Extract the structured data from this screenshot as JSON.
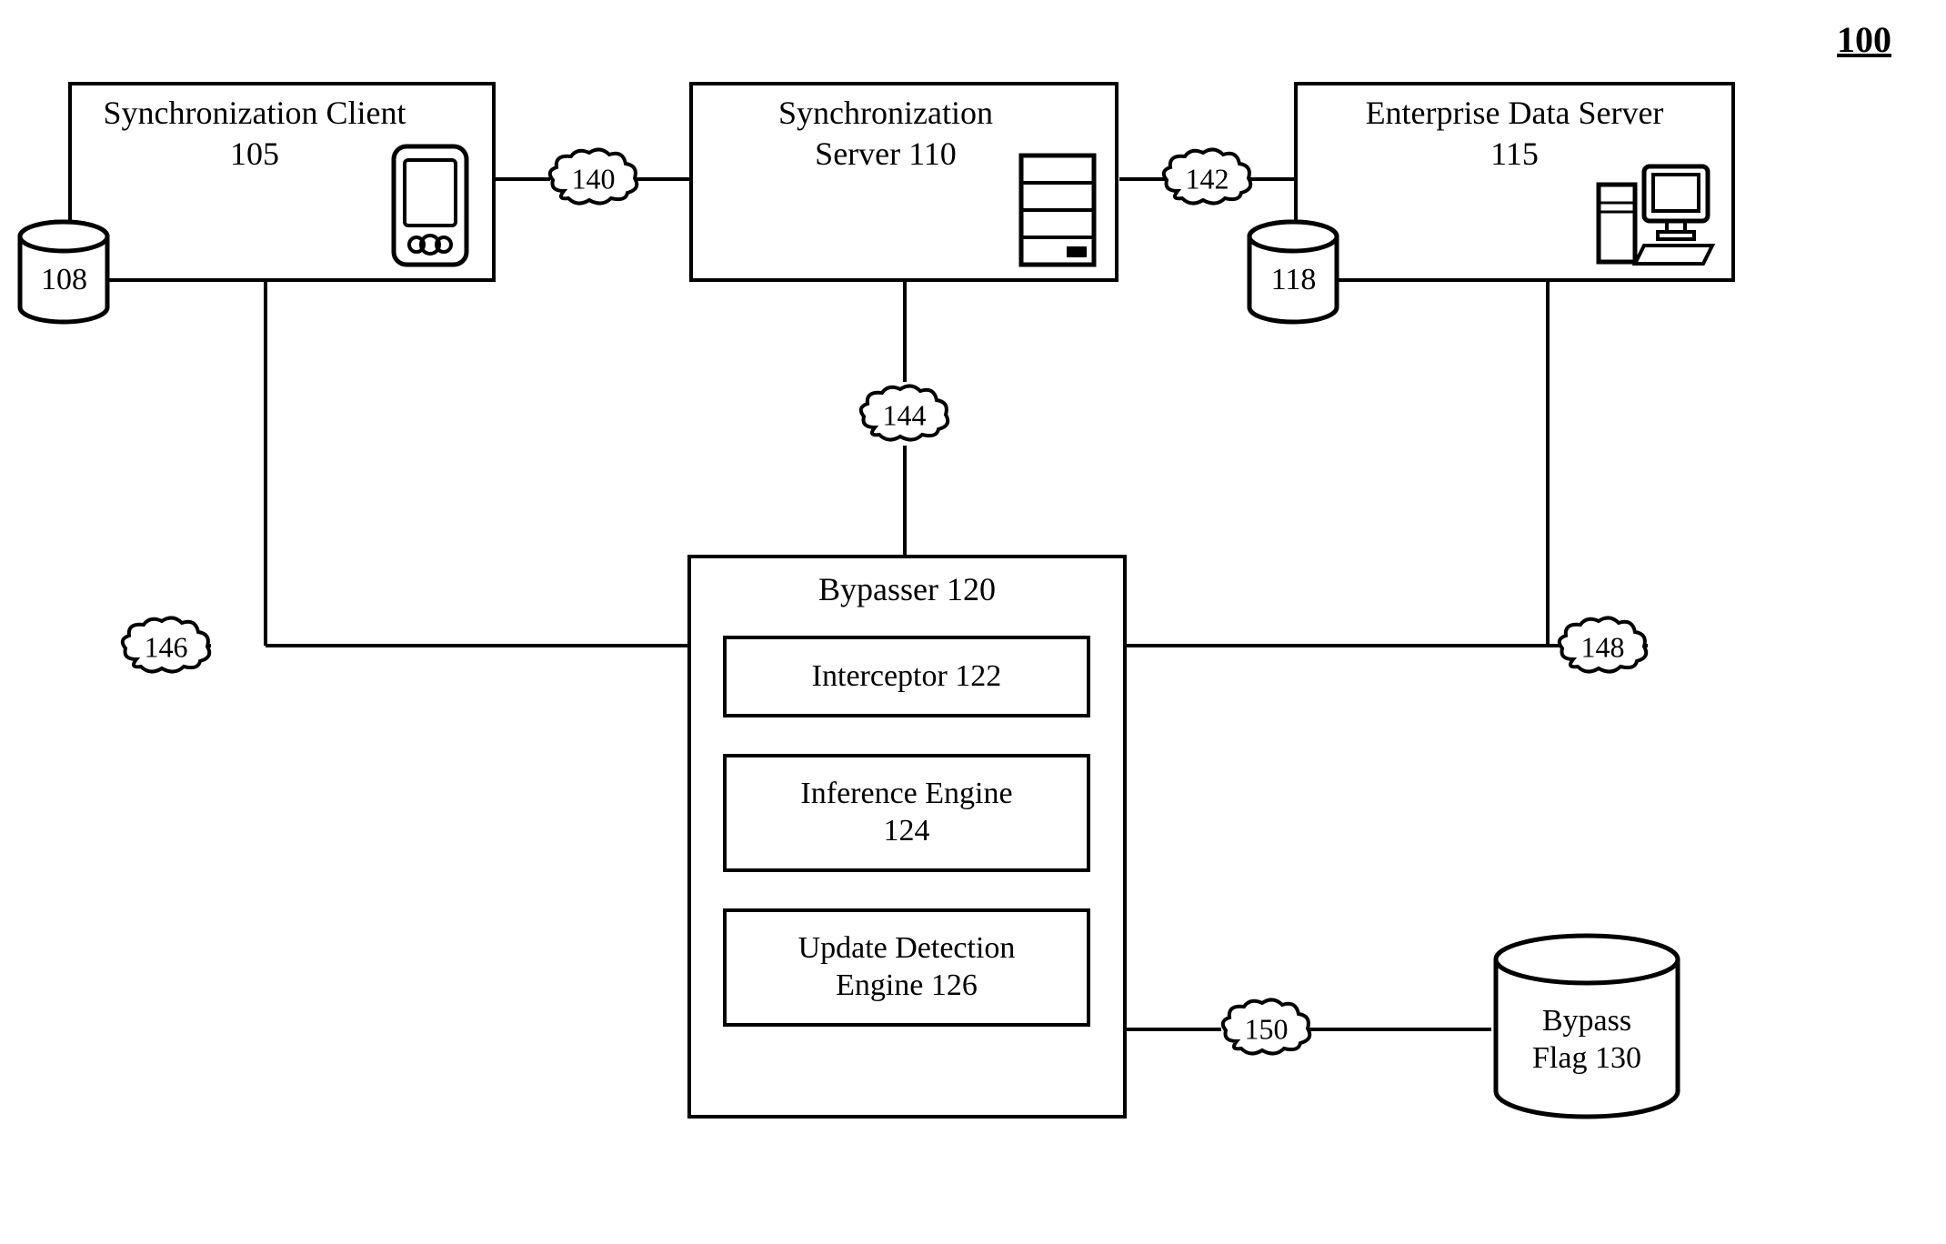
{
  "figure_number": "100",
  "boxes": {
    "sync_client": {
      "label": "Synchronization Client\n105"
    },
    "sync_server": {
      "label": "Synchronization\nServer 110"
    },
    "enterprise": {
      "label": "Enterprise Data Server\n115"
    },
    "bypasser": {
      "label": "Bypasser 120"
    },
    "interceptor": {
      "label": "Interceptor 122"
    },
    "inference": {
      "label": "Inference Engine\n124"
    },
    "update_detection": {
      "label": "Update Detection\nEngine 126"
    }
  },
  "cylinders": {
    "db108": {
      "label": "108"
    },
    "db118": {
      "label": "118"
    },
    "bypass_flag": {
      "label": "Bypass\nFlag 130"
    }
  },
  "clouds": {
    "c140": {
      "label": "140"
    },
    "c142": {
      "label": "142"
    },
    "c144": {
      "label": "144"
    },
    "c146": {
      "label": "146"
    },
    "c148": {
      "label": "148"
    },
    "c150": {
      "label": "150"
    }
  }
}
